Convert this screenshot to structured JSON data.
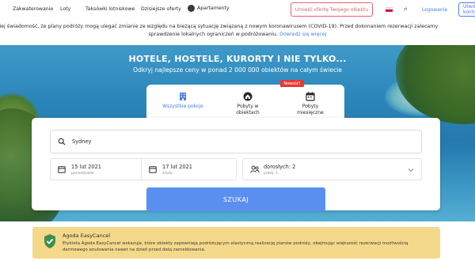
{
  "nav": {
    "accommodation": "Zakwaterowanie",
    "flights": "Loty",
    "taxi": "Taksówki lotniskowe",
    "deals": "Dzisiejsze oferty",
    "apartments": "Apartamenty",
    "list_property": "Umieść ofertę Twojego obiektu",
    "currency": "zł",
    "login": "Logowanie",
    "register": "Utwórz konto"
  },
  "notice": {
    "line1": "Miej świadomość, że plany podróży mogą ulegać zmianie ze względu na bieżącą sytuację związaną z nowym koronawirusem (COVID-19). Przed dokonaniem rezerwacji zalecamy",
    "line2": "sprawdzenie lokalnych ograniczeń w podróżowaniu.",
    "link": "Dowiedz się więcej"
  },
  "hero": {
    "title": "HOTELE, HOSTELE, KURORTY I NIE TYLKO...",
    "subtitle": "Odkryj najlepsze ceny w ponad 2 000 000 obiektów na całym świecie"
  },
  "tabs": [
    {
      "label": "Wszystkie pokoje",
      "icon": "building-icon",
      "active": true
    },
    {
      "label": "Pobyty w obiektach",
      "icon": "house-icon",
      "active": false
    },
    {
      "label": "Pobyty miesięczne",
      "icon": "calendar-icon",
      "active": false
    }
  ],
  "new_badge": "Nowość!",
  "search": {
    "destination": "Sydney",
    "checkin_date": "15 lut 2021",
    "checkin_day": "poniedziałek",
    "checkout_date": "17 lut 2021",
    "checkout_day": "środa",
    "guests": "dorosłych: 2",
    "rooms": "pokój: 1",
    "button": "SZUKAJ"
  },
  "banner": {
    "title": "Agoda EasyCancel",
    "body": "Etykieta Agoda EasyCancel wskazuje, które obiekty zapewniają podróżującym elastyczną realizację planów podróży, obejmując większość rezerwacji możliwością darmowego anulowania nawet na dzień przed datą zameldowania."
  },
  "colors": {
    "accent": "#4a7ee8",
    "search_button": "#5a8ff0",
    "list_button": "#e7606b",
    "banner_bg": "#f5d98a",
    "badge": "#e53935"
  }
}
